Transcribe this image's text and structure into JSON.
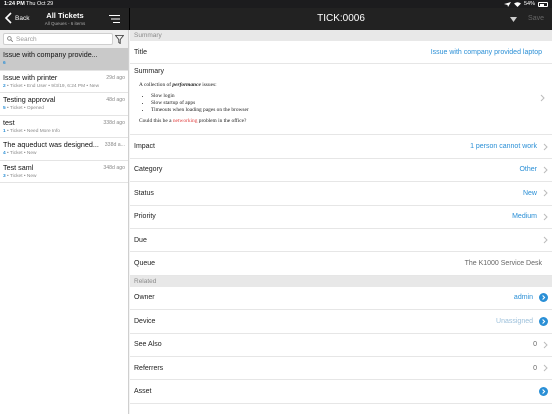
{
  "status_bar": {
    "time": "1:24 PM",
    "date": "Thu Oct 29",
    "battery": "54%"
  },
  "left_nav": {
    "back_label": "Back",
    "title": "All Tickets",
    "subtitle": "All Queues - 6 items"
  },
  "search": {
    "placeholder": "Search"
  },
  "tickets": [
    {
      "title": "Issue with company provide...",
      "age": "",
      "num": "6",
      "meta": ""
    },
    {
      "title": "Issue with printer",
      "age": "29d ago",
      "num": "2",
      "meta": " • Ticket • End User • 9/3/19, 6:24 PM • New"
    },
    {
      "title": "Testing approval",
      "age": "48d ago",
      "num": "5",
      "meta": " • Ticket • Opened"
    },
    {
      "title": "test",
      "age": "338d ago",
      "num": "1",
      "meta": " • Ticket • Need More Info"
    },
    {
      "title": "The aqueduct was designed...",
      "age": "338d a...",
      "num": "4",
      "meta": " • Ticket • New"
    },
    {
      "title": "Test saml",
      "age": "348d ago",
      "num": "3",
      "meta": " • Ticket • New"
    }
  ],
  "right_nav": {
    "title": "TICK:0006",
    "save_label": "Save"
  },
  "detail": {
    "summary_header": "Summary",
    "title_label": "Title",
    "title_value": "Issue with company provided laptop",
    "summary_label": "Summary",
    "summary_intro_pre": "A collection of ",
    "summary_intro_em": "performance",
    "summary_intro_post": " issues:",
    "summary_items": [
      "Slow login",
      "Slow startup of apps",
      "Timeouts when loading pages on the browser"
    ],
    "summary_q_pre": "Could this be a ",
    "summary_q_red": "networking",
    "summary_q_post": " problem in the office?",
    "impact_label": "Impact",
    "impact_value": "1 person cannot work",
    "category_label": "Category",
    "category_value": "Other",
    "status_label": "Status",
    "status_value": "New",
    "priority_label": "Priority",
    "priority_value": "Medium",
    "due_label": "Due",
    "queue_label": "Queue",
    "queue_value": "The K1000 Service Desk",
    "related_header": "Related",
    "owner_label": "Owner",
    "owner_value": "admin",
    "device_label": "Device",
    "device_value": "Unassigned",
    "see_also_label": "See Also",
    "see_also_value": "0",
    "referrers_label": "Referrers",
    "referrers_value": "0",
    "asset_label": "Asset"
  },
  "colors": {
    "accent": "#2a8fd6",
    "nav_bg": "#222222",
    "selected_row": "#c9c9c9"
  },
  "icons": {
    "back": "chevron-left-icon",
    "sort": "sort-lines-icon",
    "search": "magnifier-icon",
    "filter": "funnel-icon",
    "dropdown": "caret-down-icon",
    "disclosure": "chevron-right-icon",
    "link": "circle-arrow-right-icon"
  }
}
